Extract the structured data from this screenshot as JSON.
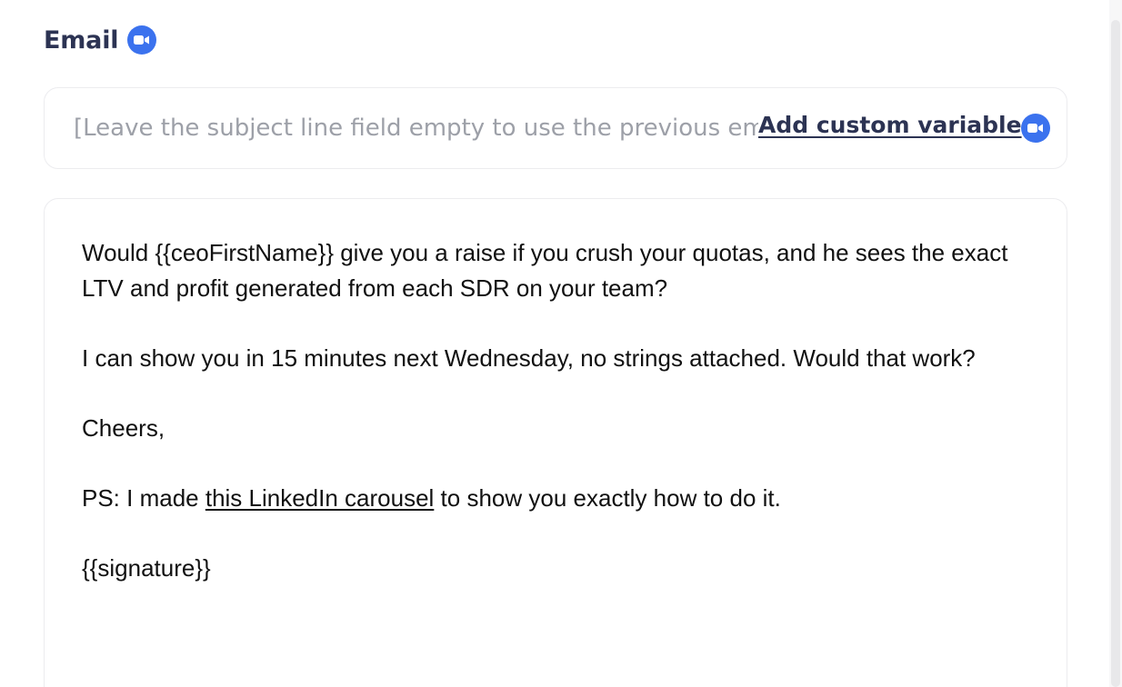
{
  "section": {
    "title": "Email",
    "icon": "video-camera-icon",
    "accent_color": "#3b72ee"
  },
  "subject": {
    "value": "",
    "placeholder": "[Leave the subject line field empty to use the previous email's subject]",
    "add_variable_label": "Add custom variable",
    "icon": "video-camera-icon"
  },
  "body": {
    "p1": "Would {{ceoFirstName}} give you a raise if you crush your quotas, and he sees the exact LTV and profit generated from each SDR on your team?",
    "p2": "I can show you in 15 minutes next Wednesday, no strings attached. Would that work?",
    "p3": "Cheers,",
    "p4_before": "PS: I made ",
    "p4_link": "this LinkedIn carousel",
    "p4_after": " to show you exactly how to do it.",
    "p5": "{{signature}}"
  }
}
